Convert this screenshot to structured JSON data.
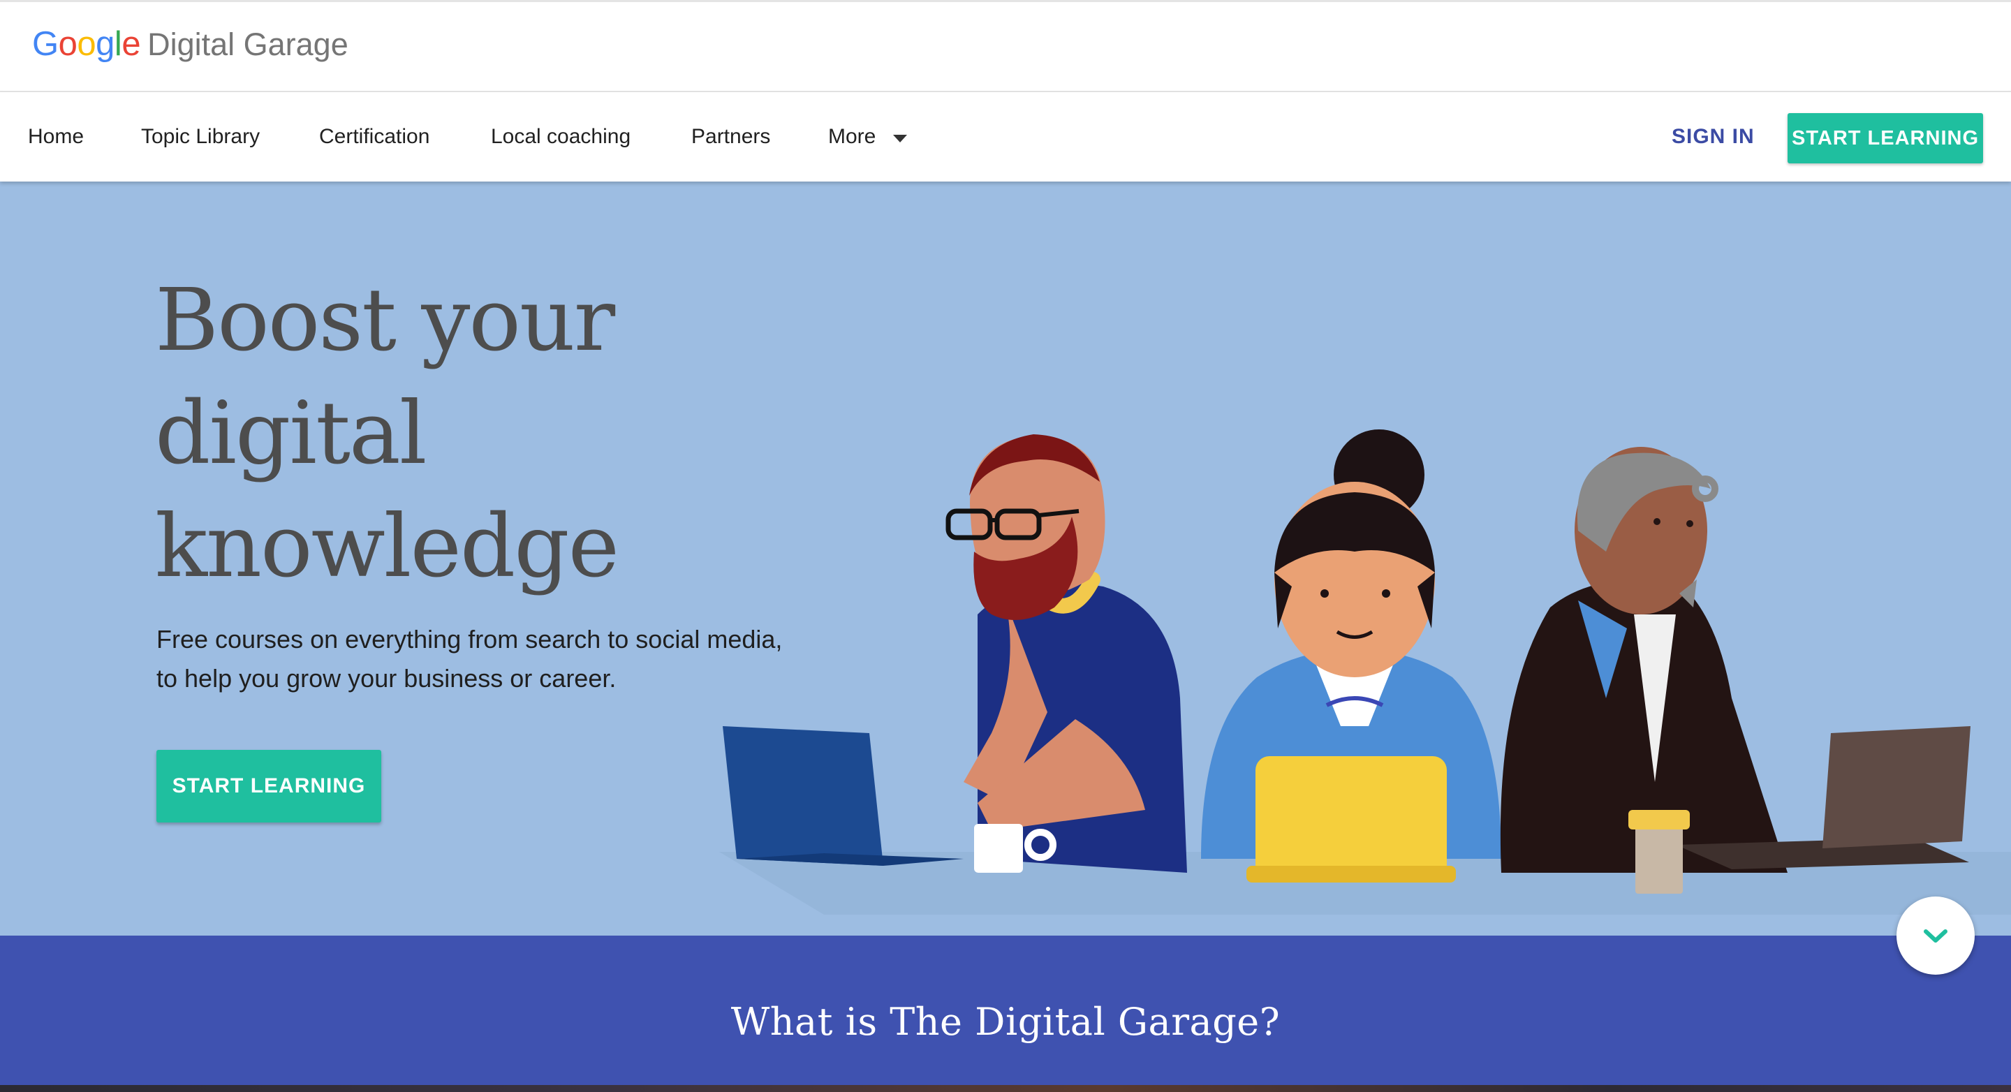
{
  "brand": {
    "google_letters": [
      {
        "char": "G",
        "color": "#4285F4"
      },
      {
        "char": "o",
        "color": "#EA4335"
      },
      {
        "char": "o",
        "color": "#FBBC05"
      },
      {
        "char": "g",
        "color": "#4285F4"
      },
      {
        "char": "l",
        "color": "#34A853"
      },
      {
        "char": "e",
        "color": "#EA4335"
      }
    ],
    "product": "Digital Garage"
  },
  "nav": {
    "items": [
      {
        "label": "Home"
      },
      {
        "label": "Topic Library"
      },
      {
        "label": "Certification"
      },
      {
        "label": "Local coaching"
      },
      {
        "label": "Partners"
      },
      {
        "label": "More"
      }
    ],
    "sign_in": "SIGN IN",
    "start_learning": "START LEARNING"
  },
  "hero": {
    "title": "Boost your digital knowledge",
    "subtitle_line1": "Free courses on everything from search to social media,",
    "subtitle_line2": "to help you grow your business or career.",
    "cta": "START LEARNING"
  },
  "section": {
    "title": "What is The Digital Garage?"
  },
  "icons": {
    "nav_more": "caret-down-icon",
    "scroll": "chevron-down-icon"
  },
  "colors": {
    "accent": "#1fbf9f",
    "hero_bg": "#9dbde2",
    "section_bg": "#3f52b0",
    "sign_in": "#3b4ba4"
  }
}
